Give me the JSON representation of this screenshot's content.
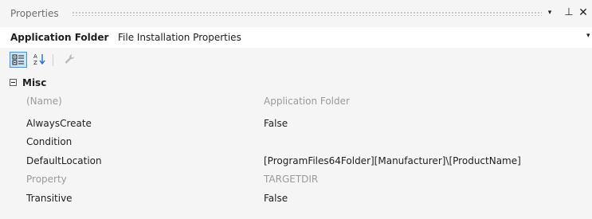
{
  "window": {
    "title": "Properties",
    "buttons": {
      "dropdown": "▾",
      "pin": "⊥",
      "close": "✕"
    }
  },
  "object_selector": {
    "name": "Application Folder",
    "type": "File Installation Properties",
    "dropdown": "▾"
  },
  "toolbar": {
    "items": [
      {
        "icon": "categorized-icon",
        "active": true
      },
      {
        "icon": "alphabetical-sort-icon",
        "active": false
      },
      {
        "icon": "wrench-icon",
        "active": false,
        "enabled": false
      }
    ]
  },
  "grid": {
    "category": {
      "label": "Misc",
      "expanded": true
    },
    "properties": [
      {
        "name": "(Name)",
        "value": "Application Folder",
        "readonly": true
      },
      {
        "name": "AlwaysCreate",
        "value": "False",
        "readonly": false
      },
      {
        "name": "Condition",
        "value": "",
        "readonly": false
      },
      {
        "name": "DefaultLocation",
        "value": "[ProgramFiles64Folder][Manufacturer]\\[ProductName]",
        "readonly": false
      },
      {
        "name": "Property",
        "value": "TARGETDIR",
        "readonly": true
      },
      {
        "name": "Transitive",
        "value": "False",
        "readonly": false
      }
    ]
  },
  "colors": {
    "background": "#f5f5f5",
    "selected_toolbar_bg": "#cce4f7",
    "selected_toolbar_border": "#3399ff",
    "readonly_text": "#9a9a9a"
  }
}
